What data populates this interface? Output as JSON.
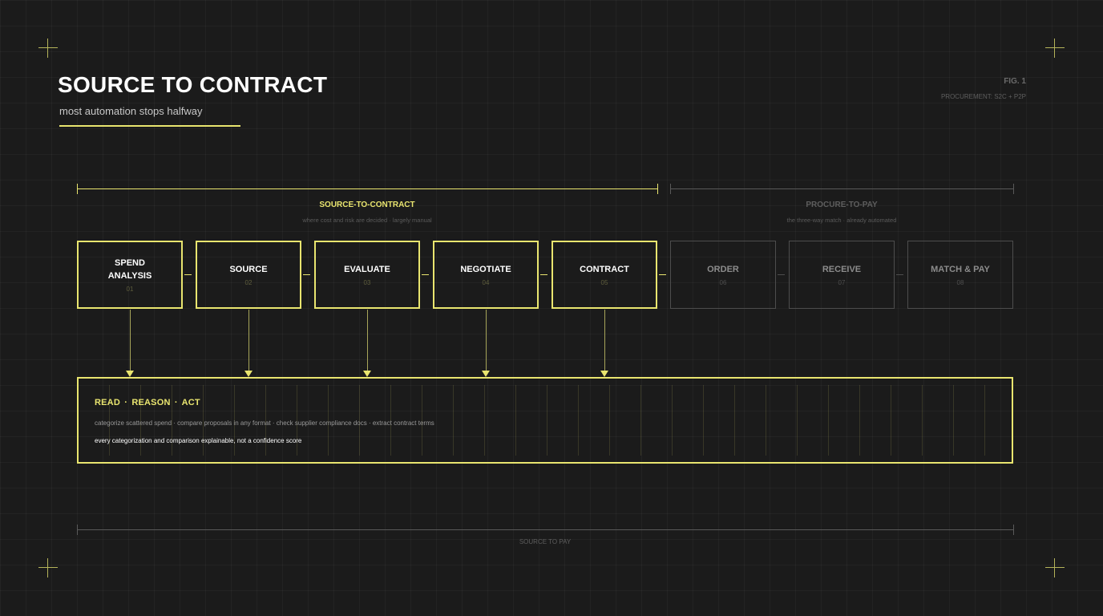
{
  "header": {
    "title": "SOURCE TO CONTRACT",
    "subtitle": "most automation stops halfway",
    "fig_label": "FIG. 1",
    "fig_caption": "PROCUREMENT: S2C + P2P"
  },
  "phases": {
    "s2c": {
      "title": "SOURCE-TO-CONTRACT",
      "subtitle": "where cost and risk are decided · largely manual"
    },
    "p2p": {
      "title": "PROCURE-TO-PAY",
      "subtitle": "the three-way match · already automated"
    }
  },
  "stages": [
    {
      "label": "SPEND\nANALYSIS",
      "number": "01",
      "status": "manual"
    },
    {
      "label": "SOURCE",
      "number": "02",
      "status": "manual"
    },
    {
      "label": "EVALUATE",
      "number": "03",
      "status": "manual"
    },
    {
      "label": "NEGOTIATE",
      "number": "04",
      "status": "manual"
    },
    {
      "label": "CONTRACT",
      "number": "05",
      "status": "manual"
    },
    {
      "label": "ORDER",
      "number": "06",
      "status": "automated"
    },
    {
      "label": "RECEIVE",
      "number": "07",
      "status": "automated"
    },
    {
      "label": "MATCH & PAY",
      "number": "08",
      "status": "automated"
    }
  ],
  "engine": {
    "heading": "READ · REASON · ACT",
    "detail": "categorize scattered spend · compare proposals in any format · check supplier compliance docs · extract contract terms",
    "note": "every categorization and comparison explainable, not a confidence score"
  },
  "footer": {
    "label": "SOURCE TO PAY"
  },
  "colors": {
    "accent": "#e9e56f",
    "muted": "#4d4d4d",
    "background": "#1b1b1b"
  }
}
